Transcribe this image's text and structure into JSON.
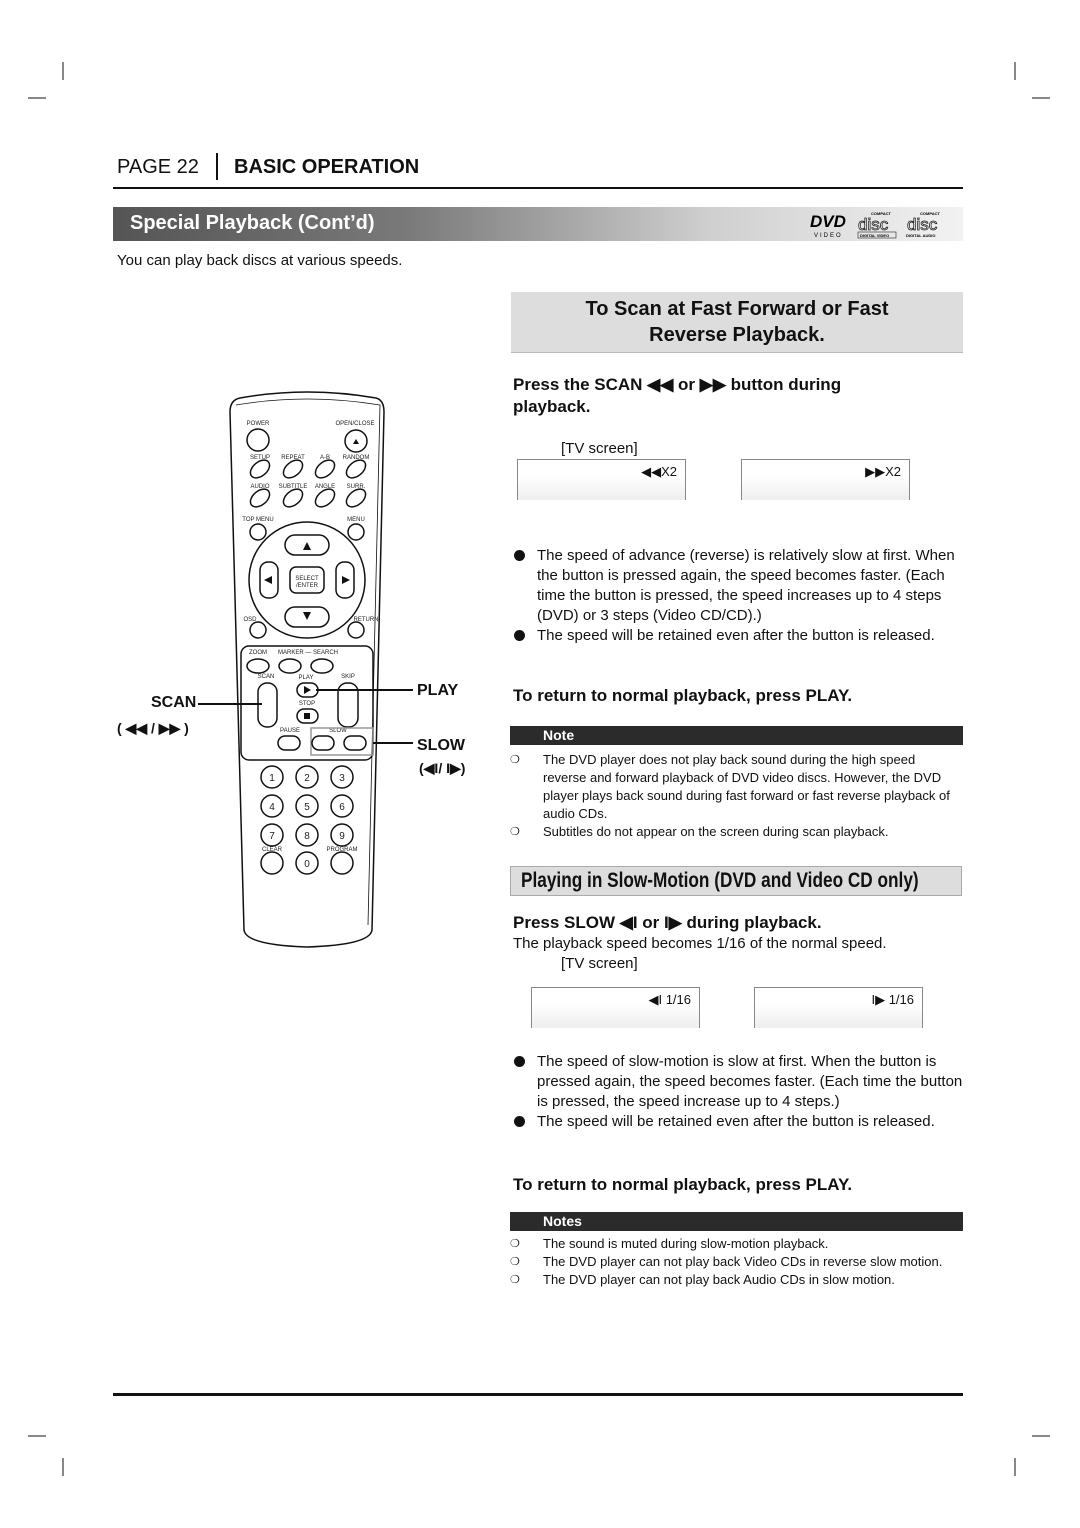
{
  "header": {
    "page": "PAGE 22",
    "section": "BASIC OPERATION"
  },
  "title": "Special Playback (Cont’d)",
  "logos": {
    "dvd": "DVD",
    "dvd_sub": "VIDEO",
    "cd1_top": "COMPACT",
    "cd1_word": "disc",
    "cd1_bottom": "DIGITAL VIDEO",
    "cd2_top": "COMPACT",
    "cd2_word": "disc",
    "cd2_bottom": "DIGITAL AUDIO"
  },
  "intro": "You can play back discs at various speeds.",
  "scan": {
    "heading_line1": "To Scan at Fast Forward or Fast",
    "heading_line2": "Reverse Playback.",
    "instruction_a": "Press the SCAN ◀◀ or ▶▶ button during",
    "instruction_b": "playback.",
    "tv_label": "[TV screen]",
    "tv_screens": [
      "◀◀X2",
      "▶▶X2"
    ],
    "bullets": [
      "The speed of advance (reverse) is relatively slow at first. When the button is pressed again, the speed becomes faster. (Each time the button is pressed, the speed increases up to 4 steps (DVD) or 3 steps (Video CD/CD).)",
      "The speed will be retained even after the button is released."
    ],
    "return": "To return to normal playback, press PLAY.",
    "note_title": "Note",
    "notes": [
      "The DVD player does not play back sound during the high speed reverse and forward playback of DVD video discs. However, the DVD player plays back sound during fast forward or fast reverse playback of audio CDs.",
      "Subtitles do not appear on the screen during scan playback."
    ]
  },
  "slow": {
    "heading": "Playing in Slow-Motion (DVD and Video CD only)",
    "instruction": "Press SLOW ◀I or I▶ during playback.",
    "desc": "The playback speed becomes 1/16 of the normal speed.",
    "tv_label": "[TV screen]",
    "tv_screens": [
      "◀I 1/16",
      "I▶ 1/16"
    ],
    "bullets": [
      "The speed of slow-motion is slow at first. When the button is pressed again, the speed becomes faster. (Each time the button is pressed, the speed increase up to 4 steps.)",
      "The speed will be retained even after the button is released."
    ],
    "return": "To return to normal playback, press PLAY.",
    "note_title": "Notes",
    "notes": [
      "The sound is muted during slow-motion playback.",
      "The DVD player can not play back Video CDs in reverse slow motion.",
      "The DVD player can not play back Audio CDs in slow motion."
    ]
  },
  "callouts": {
    "scan": "SCAN",
    "scan_sub": "( ◀◀ / ▶▶ )",
    "play": "PLAY",
    "slow": "SLOW",
    "slow_sub": "(◀I/ I▶)"
  },
  "remote": {
    "power": "POWER",
    "open_close": "OPEN/CLOSE",
    "setup": "SETUP",
    "repeat": "REPEAT",
    "ab": "A-B",
    "random": "RANDOM",
    "audio": "AUDIO",
    "subtitle": "SUBTITLE",
    "angle": "ANGLE",
    "surr": "SURR.",
    "top_menu": "TOP MENU",
    "menu": "MENU",
    "select1": "SELECT",
    "select2": "/ENTER",
    "osd": "OSD",
    "return": "RETURN",
    "zoom": "ZOOM",
    "marker_search": "MARKER — SEARCH",
    "scan": "SCAN",
    "play": "PLAY",
    "skip": "SKIP",
    "stop": "STOP",
    "pause": "PAUSE",
    "slow": "SLOW",
    "digits": [
      "1",
      "2",
      "3",
      "4",
      "5",
      "6",
      "7",
      "8",
      "9",
      "0"
    ],
    "clear": "CLEAR",
    "program": "PROGRAM"
  }
}
